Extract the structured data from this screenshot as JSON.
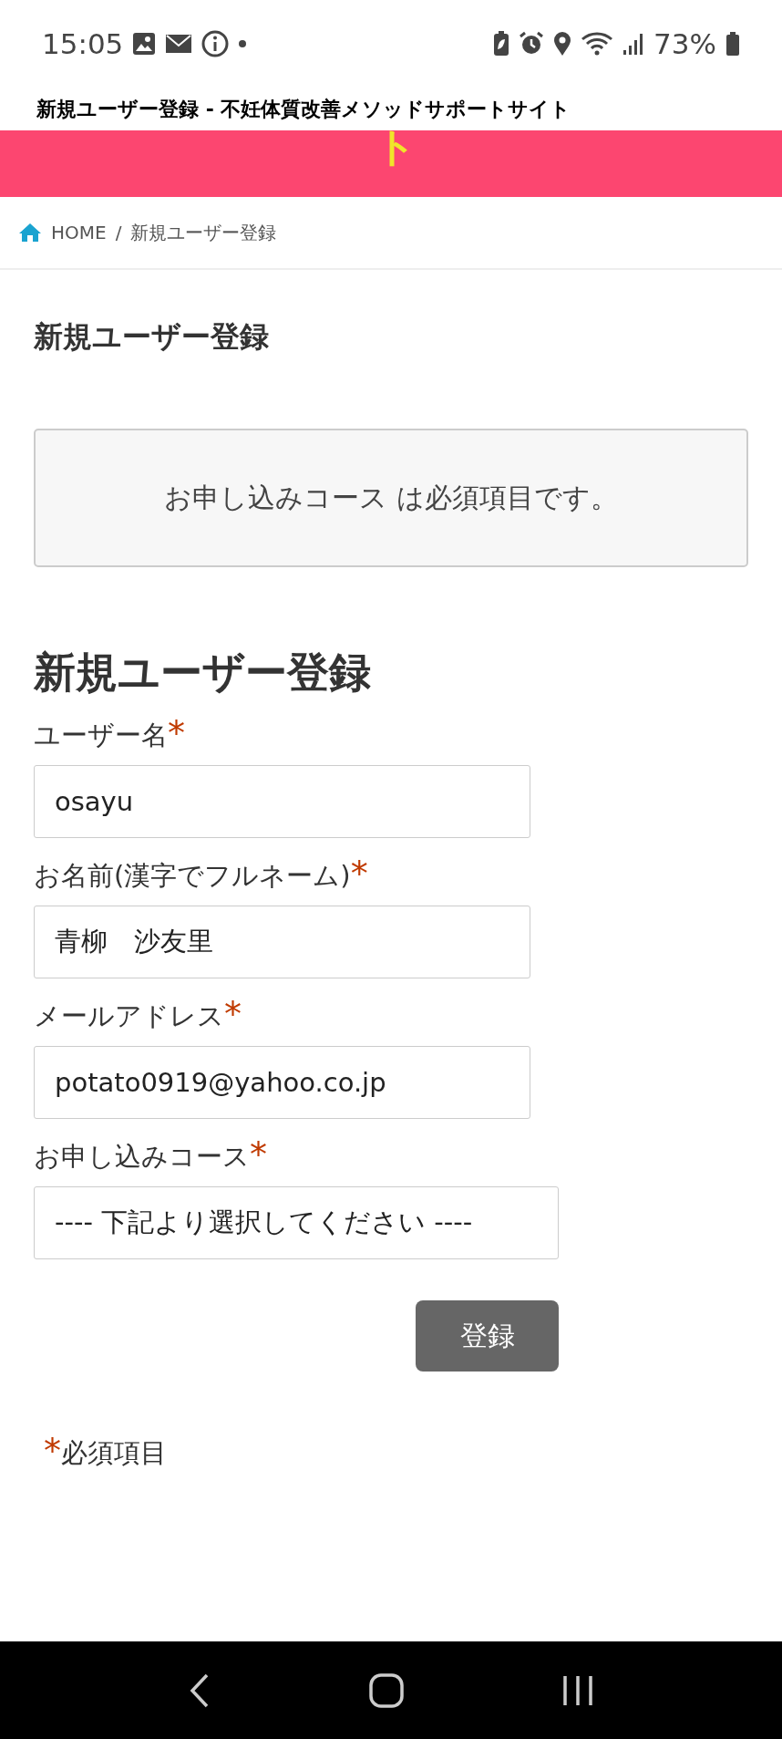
{
  "status_bar": {
    "time": "15:05",
    "battery": "73%"
  },
  "page_title": "新規ユーザー登録 - 不妊体質改善メソッドサポートサイト",
  "banner": {
    "text": "ト"
  },
  "breadcrumb": {
    "items": [
      {
        "label": "HOME"
      },
      {
        "label": "新規ユーザー登録"
      }
    ],
    "separator": "/"
  },
  "heading": "新規ユーザー登録",
  "error_message": "お申し込みコース は必須項目です。",
  "form": {
    "title": "新規ユーザー登録",
    "fields": [
      {
        "kind": "text",
        "label": "ユーザー名",
        "required_mark": "*",
        "value": "osayu"
      },
      {
        "kind": "text",
        "label": "お名前(漢字でフルネーム)",
        "required_mark": "*",
        "value": "青柳　沙友里"
      },
      {
        "kind": "text",
        "label": "メールアドレス",
        "required_mark": "*",
        "value": "potato0919@yahoo.co.jp"
      },
      {
        "kind": "select",
        "label": "お申し込みコース",
        "required_mark": "*",
        "value": "---- 下記より選択してください ----"
      }
    ],
    "submit": "登録"
  },
  "required_note": {
    "mark": "*",
    "text": "必須項目"
  }
}
